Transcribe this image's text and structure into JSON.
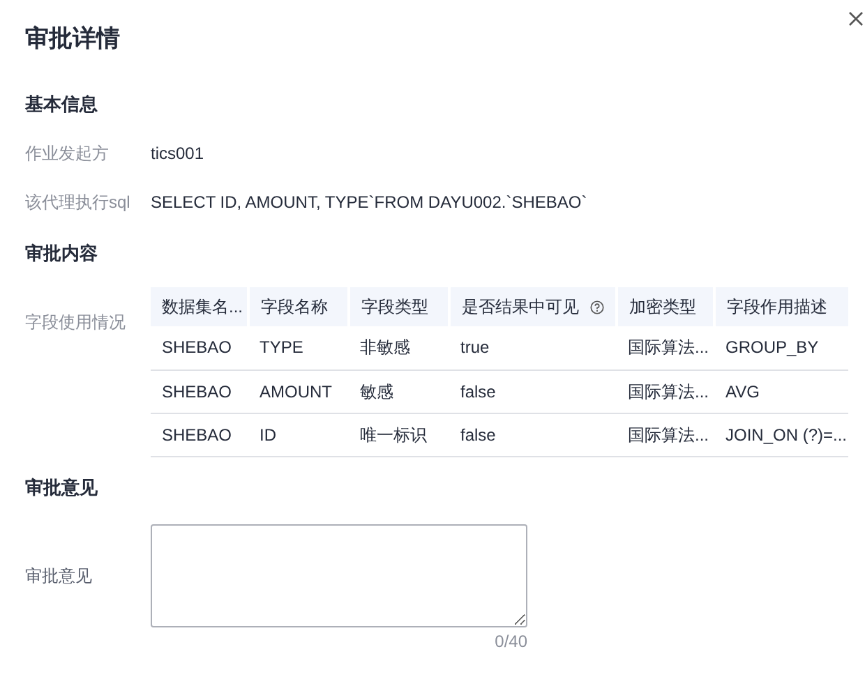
{
  "dialog": {
    "title": "审批详情"
  },
  "basic_info": {
    "heading": "基本信息",
    "fields": [
      {
        "label": "作业发起方",
        "value": "tics001"
      },
      {
        "label": "该代理执行sql",
        "value": "SELECT ID, AMOUNT, TYPE`FROM DAYU002.`SHEBAO`"
      }
    ]
  },
  "approval_content": {
    "heading": "审批内容",
    "label": "字段使用情况",
    "table": {
      "columns": [
        {
          "label": "数据集名...",
          "help": false
        },
        {
          "label": "字段名称",
          "help": false
        },
        {
          "label": "字段类型",
          "help": false
        },
        {
          "label": "是否结果中可见",
          "help": true
        },
        {
          "label": "加密类型",
          "help": false
        },
        {
          "label": "字段作用描述",
          "help": false
        }
      ],
      "rows": [
        [
          "SHEBAO",
          "TYPE",
          "非敏感",
          "true",
          "国际算法...",
          "GROUP_BY"
        ],
        [
          "SHEBAO",
          "AMOUNT",
          "敏感",
          "false",
          "国际算法...",
          "AVG"
        ],
        [
          "SHEBAO",
          "ID",
          "唯一标识",
          "false",
          "国际算法...",
          "JOIN_ON (?)=..."
        ]
      ]
    }
  },
  "approval_opinion": {
    "heading": "审批意见",
    "label": "审批意见",
    "counter": "0/40"
  }
}
